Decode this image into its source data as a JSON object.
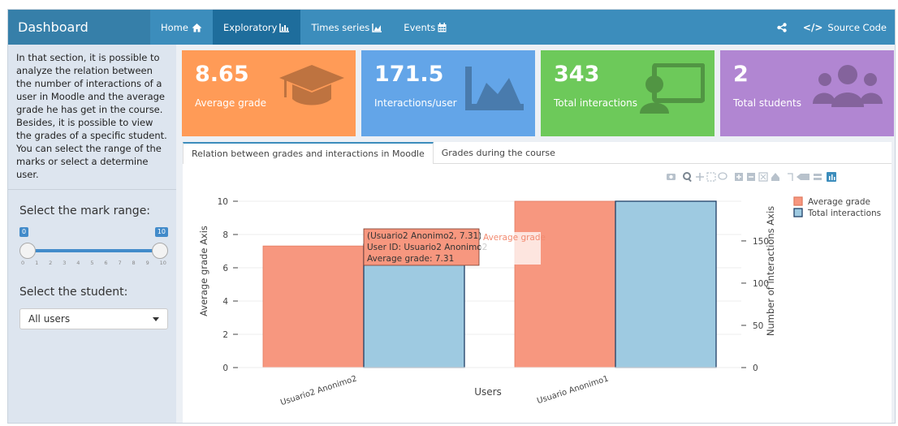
{
  "navbar": {
    "brand": "Dashboard",
    "items": [
      {
        "label": "Home",
        "icon": "home-icon",
        "active": false
      },
      {
        "label": "Exploratory",
        "icon": "bar-chart-icon",
        "active": true
      },
      {
        "label": "Times series",
        "icon": "area-chart-icon",
        "active": false
      },
      {
        "label": "Events",
        "icon": "calendar-icon",
        "active": false
      }
    ],
    "share_icon": "share-icon",
    "source_label": "Source Code"
  },
  "sidebar": {
    "intro": "In that section, it is possible to analyze the relation between the number of interactions of a user in Moodle and the average grade he has get in the course. Besides, it is possible to view the grades of a specific student. You can select the range of the marks or select a determine user.",
    "mark_range_label": "Select the mark range:",
    "range_min": "0",
    "range_max": "10",
    "ticks": [
      "0",
      "1",
      "2",
      "3",
      "4",
      "5",
      "6",
      "7",
      "8",
      "9",
      "10"
    ],
    "student_label": "Select the student:",
    "student_value": "All users"
  },
  "value_boxes": [
    {
      "value": "8.65",
      "label": "Average grade",
      "color": "#ff9b57",
      "icon": "graduation-cap-icon"
    },
    {
      "value": "171.5",
      "label": "Interactions/user",
      "color": "#63a5e8",
      "icon": "area-chart-icon"
    },
    {
      "value": "343",
      "label": "Total interactions",
      "color": "#6dc95a",
      "icon": "teacher-icon"
    },
    {
      "value": "2",
      "label": "Total students",
      "color": "#b186d2",
      "icon": "users-icon"
    }
  ],
  "tabs": [
    {
      "label": "Relation between grades and interactions in Moodle",
      "active": true
    },
    {
      "label": "Grades during the course",
      "active": false
    }
  ],
  "chart_data": {
    "type": "bar",
    "categories": [
      "Usuario2 Anonimo2",
      "Usuario Anonimo1"
    ],
    "series": [
      {
        "name": "Average grade",
        "values": [
          7.31,
          10
        ],
        "axis": "left",
        "color": "#f7977f"
      },
      {
        "name": "Total interactions",
        "values": [
          146,
          197
        ],
        "axis": "right",
        "color": "#9ecae1"
      }
    ],
    "xlabel": "Users",
    "ylabel": "Average grade Axis",
    "y2label": "Number of interactions Axis",
    "ylim": [
      0,
      10
    ],
    "y2lim": [
      0,
      197
    ],
    "yticks": [
      "0",
      "2",
      "4",
      "6",
      "8",
      "10"
    ],
    "y2ticks": [
      "0",
      "50",
      "100",
      "150"
    ],
    "legend": "top-right",
    "tooltip": {
      "title": "(Usuario2 Anonimo2, 7.31)",
      "line1": "User ID:  Usuario2 Anonimo2",
      "line2": "Average grade:  7.31",
      "side": "Average grade"
    }
  }
}
